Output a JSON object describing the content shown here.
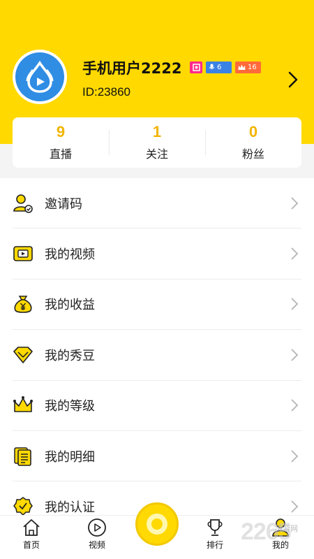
{
  "profile": {
    "name": "手机用户2222",
    "id_text": "ID:23860",
    "badges": {
      "level_blue": "6",
      "level_orange": "16"
    }
  },
  "stats": [
    {
      "value": "9",
      "label": "直播"
    },
    {
      "value": "1",
      "label": "关注"
    },
    {
      "value": "0",
      "label": "粉丝"
    }
  ],
  "menu": [
    {
      "label": "邀请码",
      "icon": "invite-icon"
    },
    {
      "label": "我的视频",
      "icon": "video-icon"
    },
    {
      "label": "我的收益",
      "icon": "money-bag-icon"
    },
    {
      "label": "我的秀豆",
      "icon": "diamond-icon"
    },
    {
      "label": "我的等级",
      "icon": "crown-icon"
    },
    {
      "label": "我的明细",
      "icon": "document-icon"
    },
    {
      "label": "我的认证",
      "icon": "verified-icon"
    }
  ],
  "tabs": [
    {
      "label": "首页",
      "icon": "home-icon"
    },
    {
      "label": "视频",
      "icon": "play-icon"
    },
    {
      "label": "排行",
      "icon": "trophy-icon"
    },
    {
      "label": "我的",
      "icon": "user-icon"
    }
  ],
  "watermark": {
    "number": "2265",
    "text": "手游网"
  },
  "colors": {
    "brand_yellow": "#ffd900",
    "stat_number": "#f2b400",
    "avatar_blue": "#2f8de4"
  }
}
